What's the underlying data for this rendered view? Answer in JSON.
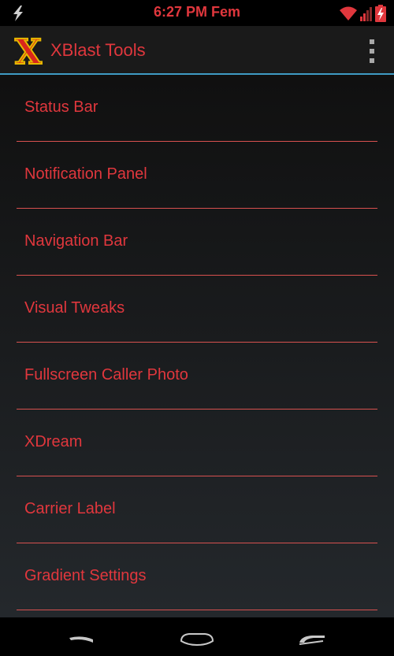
{
  "status_bar": {
    "time": "6:27 PM Fem",
    "accent_color": "#e0373d",
    "icons": [
      "flash-icon",
      "wifi-icon",
      "signal-icon",
      "battery-charging-icon"
    ]
  },
  "action_bar": {
    "logo_letter": "X",
    "title": "XBlast Tools",
    "divider_color": "#3f9bc4",
    "overflow_icon": "overflow-menu-icon"
  },
  "menu": {
    "items": [
      {
        "label": "Status Bar"
      },
      {
        "label": "Notification Panel"
      },
      {
        "label": "Navigation Bar"
      },
      {
        "label": "Visual Tweaks"
      },
      {
        "label": "Fullscreen Caller Photo"
      },
      {
        "label": "XDream"
      },
      {
        "label": "Carrier Label"
      },
      {
        "label": "Gradient Settings"
      }
    ],
    "text_color": "#e0373d",
    "divider_color": "#d8514f"
  },
  "nav_bar": {
    "buttons": [
      "back-icon",
      "home-icon",
      "recents-icon"
    ]
  }
}
